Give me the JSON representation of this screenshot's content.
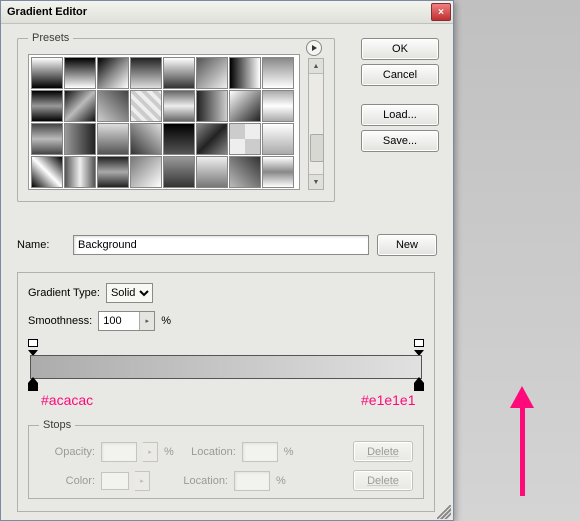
{
  "window": {
    "title": "Gradient Editor"
  },
  "presets": {
    "legend": "Presets"
  },
  "buttons": {
    "ok": "OK",
    "cancel": "Cancel",
    "load": "Load...",
    "save": "Save...",
    "new": "New",
    "delete": "Delete"
  },
  "name": {
    "label": "Name:",
    "value": "Background"
  },
  "gradient": {
    "type_label": "Gradient Type:",
    "type_value": "Solid",
    "smooth_label": "Smoothness:",
    "smooth_value": "100",
    "pct": "%",
    "stop_left_color": "#acacac",
    "stop_right_color": "#e1e1e1"
  },
  "annot": {
    "left": "#acacac",
    "right": "#e1e1e1"
  },
  "stops": {
    "legend": "Stops",
    "opacity": "Opacity:",
    "color": "Color:",
    "location": "Location:"
  }
}
